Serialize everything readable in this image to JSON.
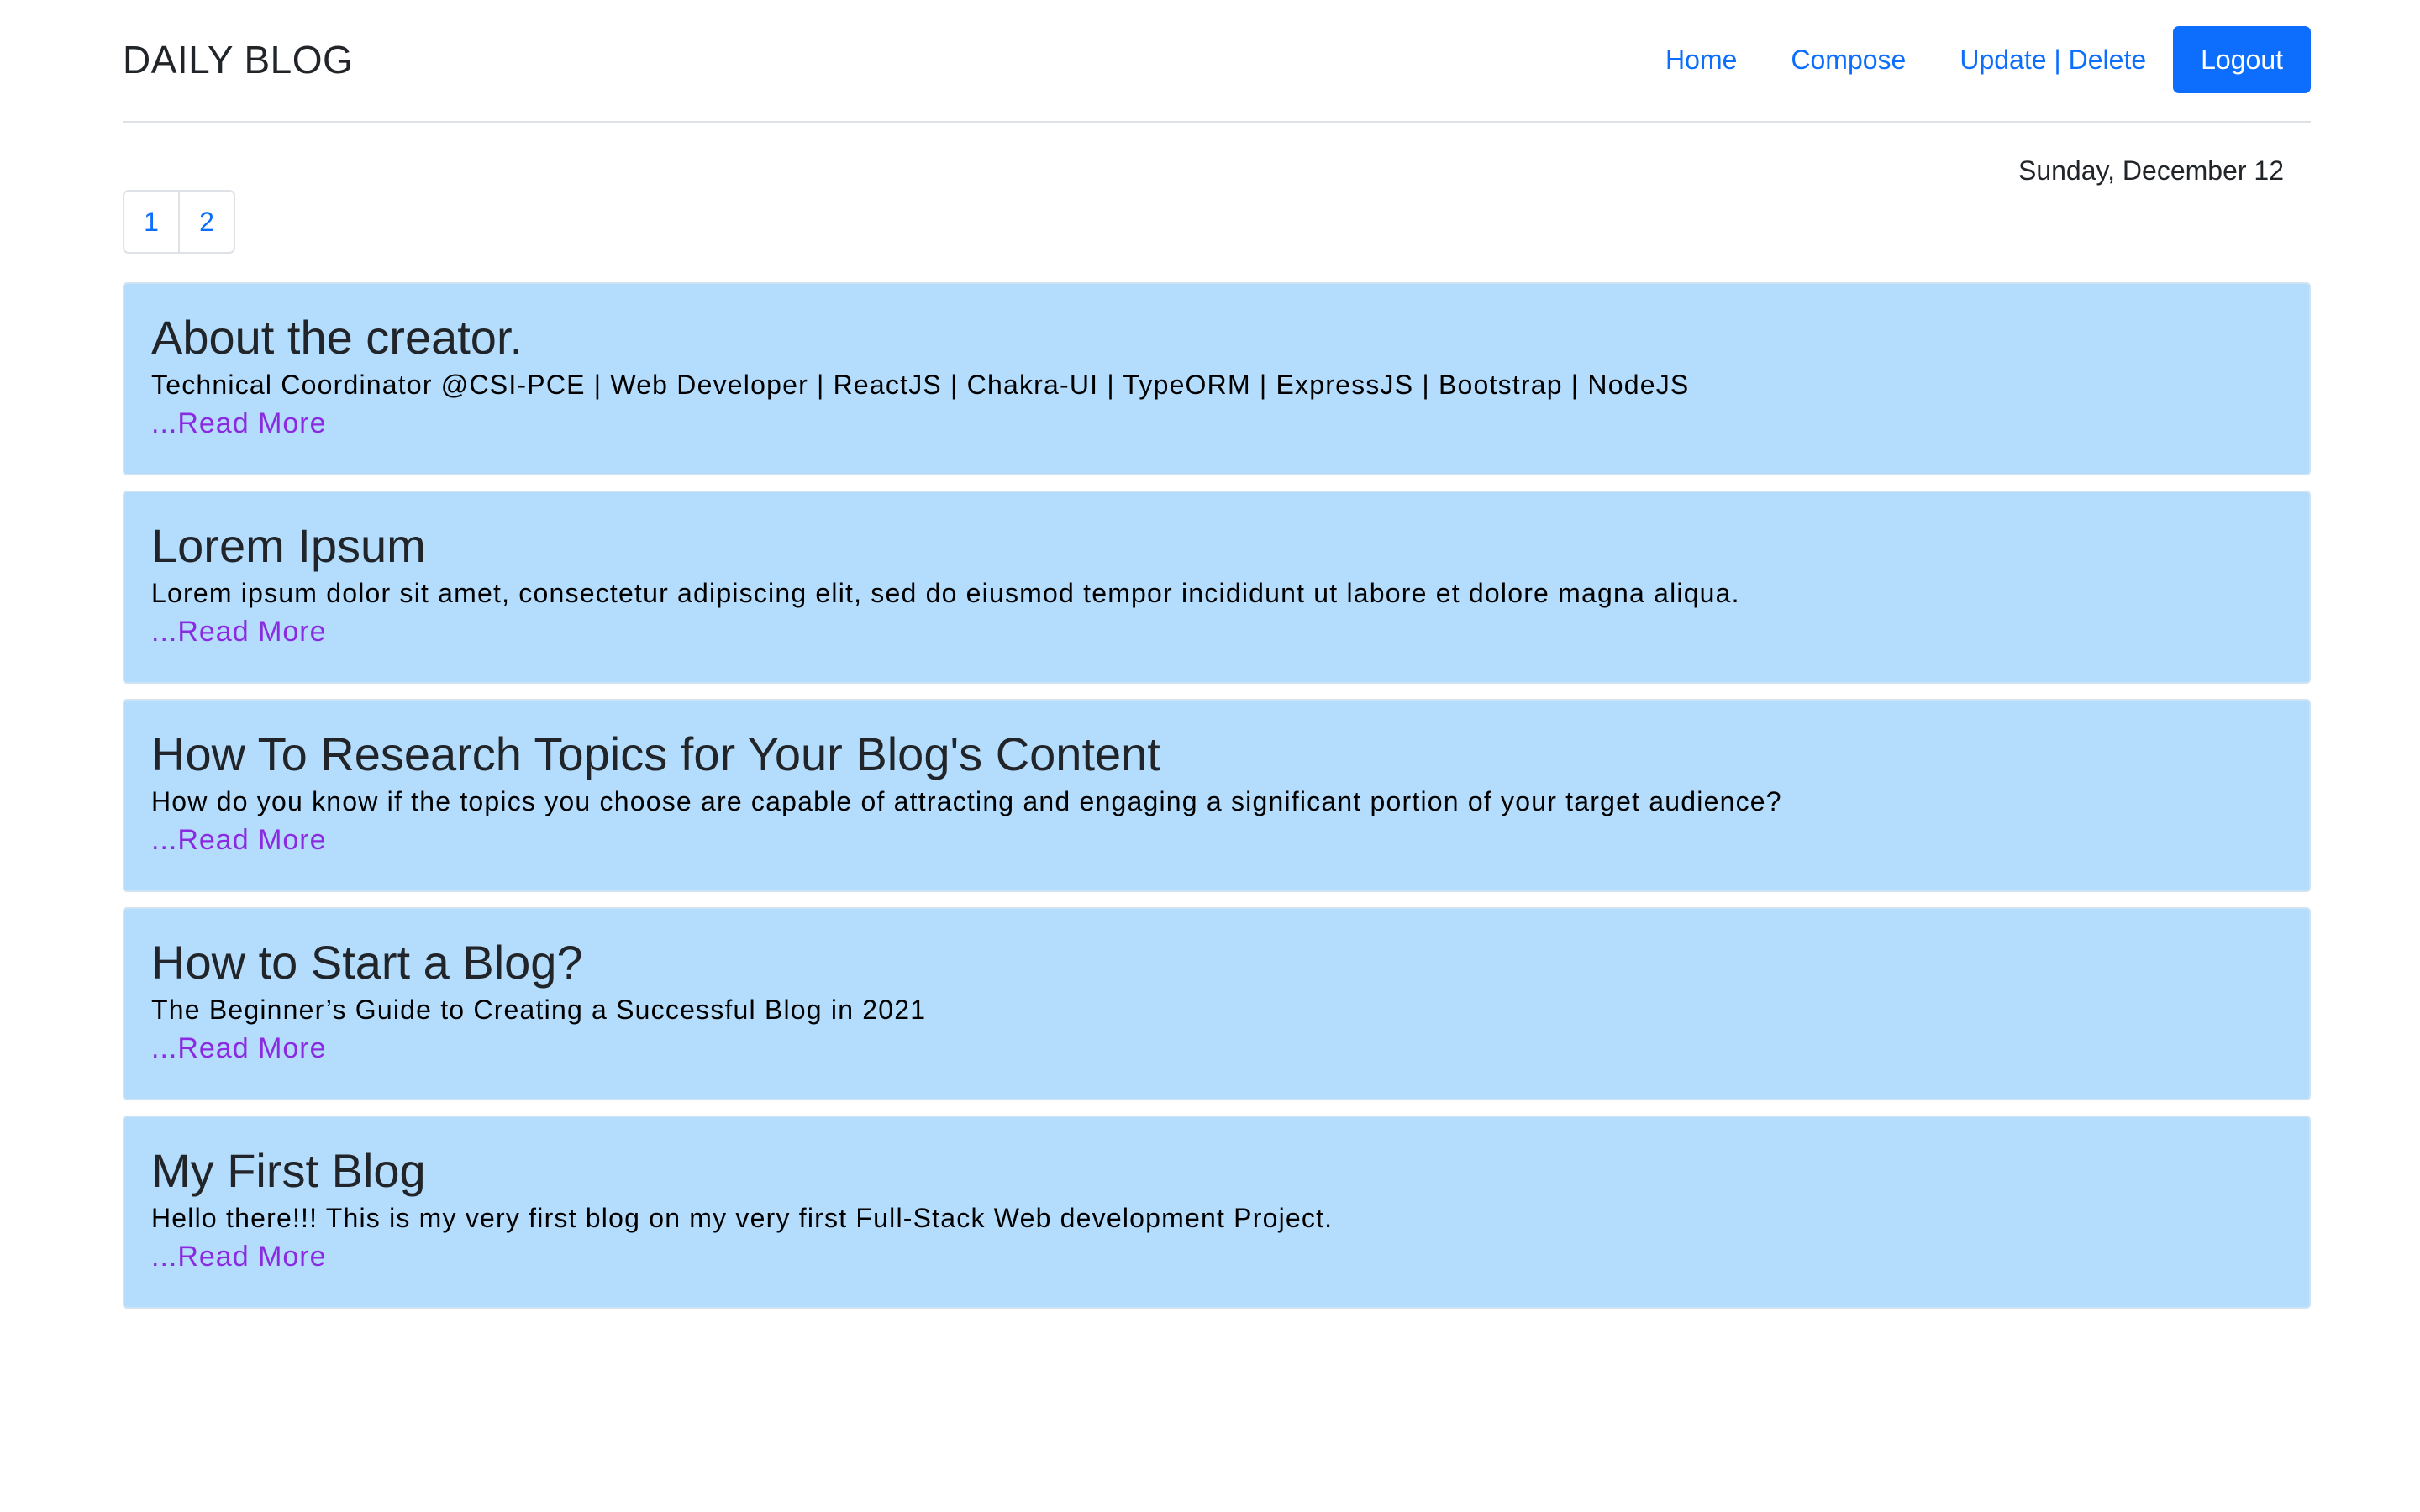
{
  "header": {
    "brand": "DAILY BLOG",
    "nav": [
      "Home",
      "Compose",
      "Update | Delete"
    ],
    "logout": "Logout"
  },
  "date": "Sunday, December 12",
  "pagination": [
    "1",
    "2"
  ],
  "read_more": "...Read More",
  "posts": [
    {
      "title": "About the creator.",
      "body": "Technical Coordinator @CSI-PCE | Web Developer | ReactJS | Chakra-UI | TypeORM | ExpressJS | Bootstrap | NodeJS"
    },
    {
      "title": "Lorem Ipsum",
      "body": "Lorem ipsum dolor sit amet, consectetur adipiscing elit, sed do eiusmod tempor incididunt ut labore et dolore magna aliqua."
    },
    {
      "title": "How To Research Topics for Your Blog's Content",
      "body": "How do you know if the topics you choose are capable of attracting and engaging a significant portion of your target audience?"
    },
    {
      "title": "How to Start a Blog?",
      "body": "The Beginner’s Guide to Creating a Successful Blog in 2021"
    },
    {
      "title": "My First Blog",
      "body": "Hello there!!! This is my very first blog on my very first Full-Stack Web development Project."
    }
  ],
  "colors": {
    "accent": "#0d6efd",
    "card_bg": "#b4dcfc",
    "read_more": "#8a2be2"
  }
}
